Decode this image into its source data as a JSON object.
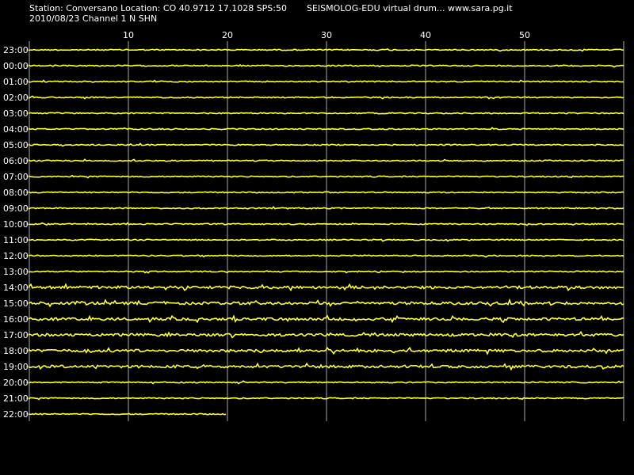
{
  "header": {
    "station_line": "Station: Conversano Location: CO 40.9712 17.1028 SPS:50",
    "title": "SEISMOLOG-EDU virtual drum... www.sara.pg.it",
    "date_line": "2010/08/23  Channel 1 N SHN"
  },
  "drum": {
    "minute_labels": [
      "10",
      "20",
      "30",
      "40",
      "50"
    ],
    "minutes_per_line": 60,
    "hour_labels": [
      "23:00",
      "00:00",
      "01:00",
      "02:00",
      "03:00",
      "04:00",
      "05:00",
      "06:00",
      "07:00",
      "08:00",
      "09:00",
      "10:00",
      "11:00",
      "12:00",
      "13:00",
      "14:00",
      "15:00",
      "16:00",
      "17:00",
      "18:00",
      "19:00",
      "20:00",
      "21:00",
      "22:00"
    ],
    "last_line_fraction": 0.333,
    "noisy_hours": [
      "14:00",
      "15:00",
      "16:00",
      "17:00",
      "18:00",
      "19:00"
    ],
    "colors": {
      "trace": "#ffff33",
      "grid": "#aaaaaa",
      "background": "#000000",
      "text": "#ffffff"
    }
  }
}
